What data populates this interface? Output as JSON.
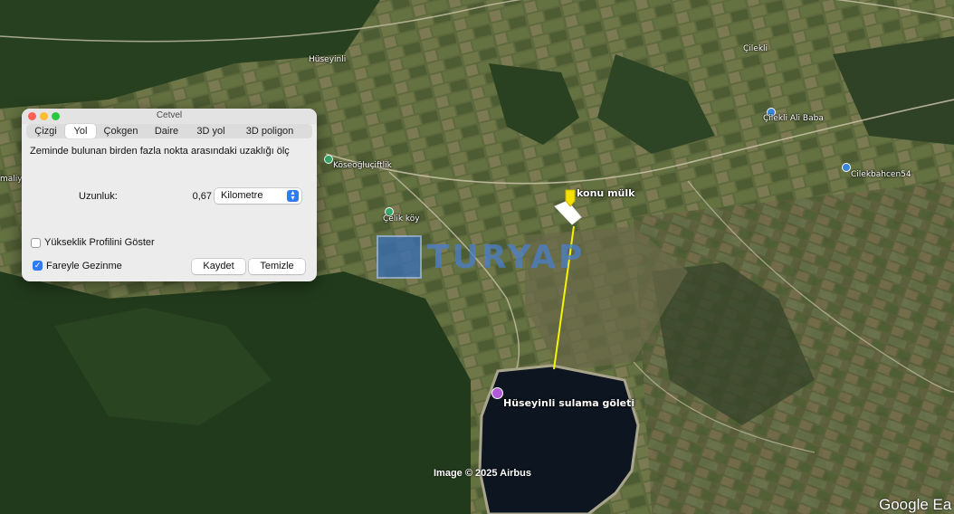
{
  "map": {
    "places": {
      "huseyinli": "Hüseyinli",
      "cilekli": "Çilekli",
      "cilekli_ali_baba": "Çilekli Ali Baba",
      "cilekbahcen": "Cilekbahcen54",
      "koseogluciftlik": "Köseoğluçiftlik",
      "celik_koy": "Çelik köy",
      "edge_label": "maliy",
      "konu_mulk": "konu mülk",
      "gölet": "Hüseyinli sulama göleti"
    },
    "attribution": "Image © 2025 Airbus",
    "google_logo": "Google Ea",
    "watermark_text": "TURYAP",
    "measure_line_color": "#f5f500",
    "pin_colors": {
      "blue": "#3b86d9",
      "green": "#36a86b",
      "purple": "#b05bd6",
      "marker": "#f5e100"
    }
  },
  "ruler": {
    "title": "Cetvel",
    "tabs": [
      "Çizgi",
      "Yol",
      "Çokgen",
      "Daire",
      "3D yol",
      "3D poligon"
    ],
    "active_tab": "Yol",
    "description": "Zeminde bulunan birden fazla nokta arasındaki uzaklığı ölç",
    "length_label": "Uzunluk:",
    "length_value": "0,67",
    "unit": "Kilometre",
    "elevation_profile_label": "Yükseklik Profilini Göster",
    "elevation_profile_checked": false,
    "mouse_nav_label": "Fareyle Gezinme",
    "mouse_nav_checked": true,
    "save_label": "Kaydet",
    "clear_label": "Temizle"
  }
}
